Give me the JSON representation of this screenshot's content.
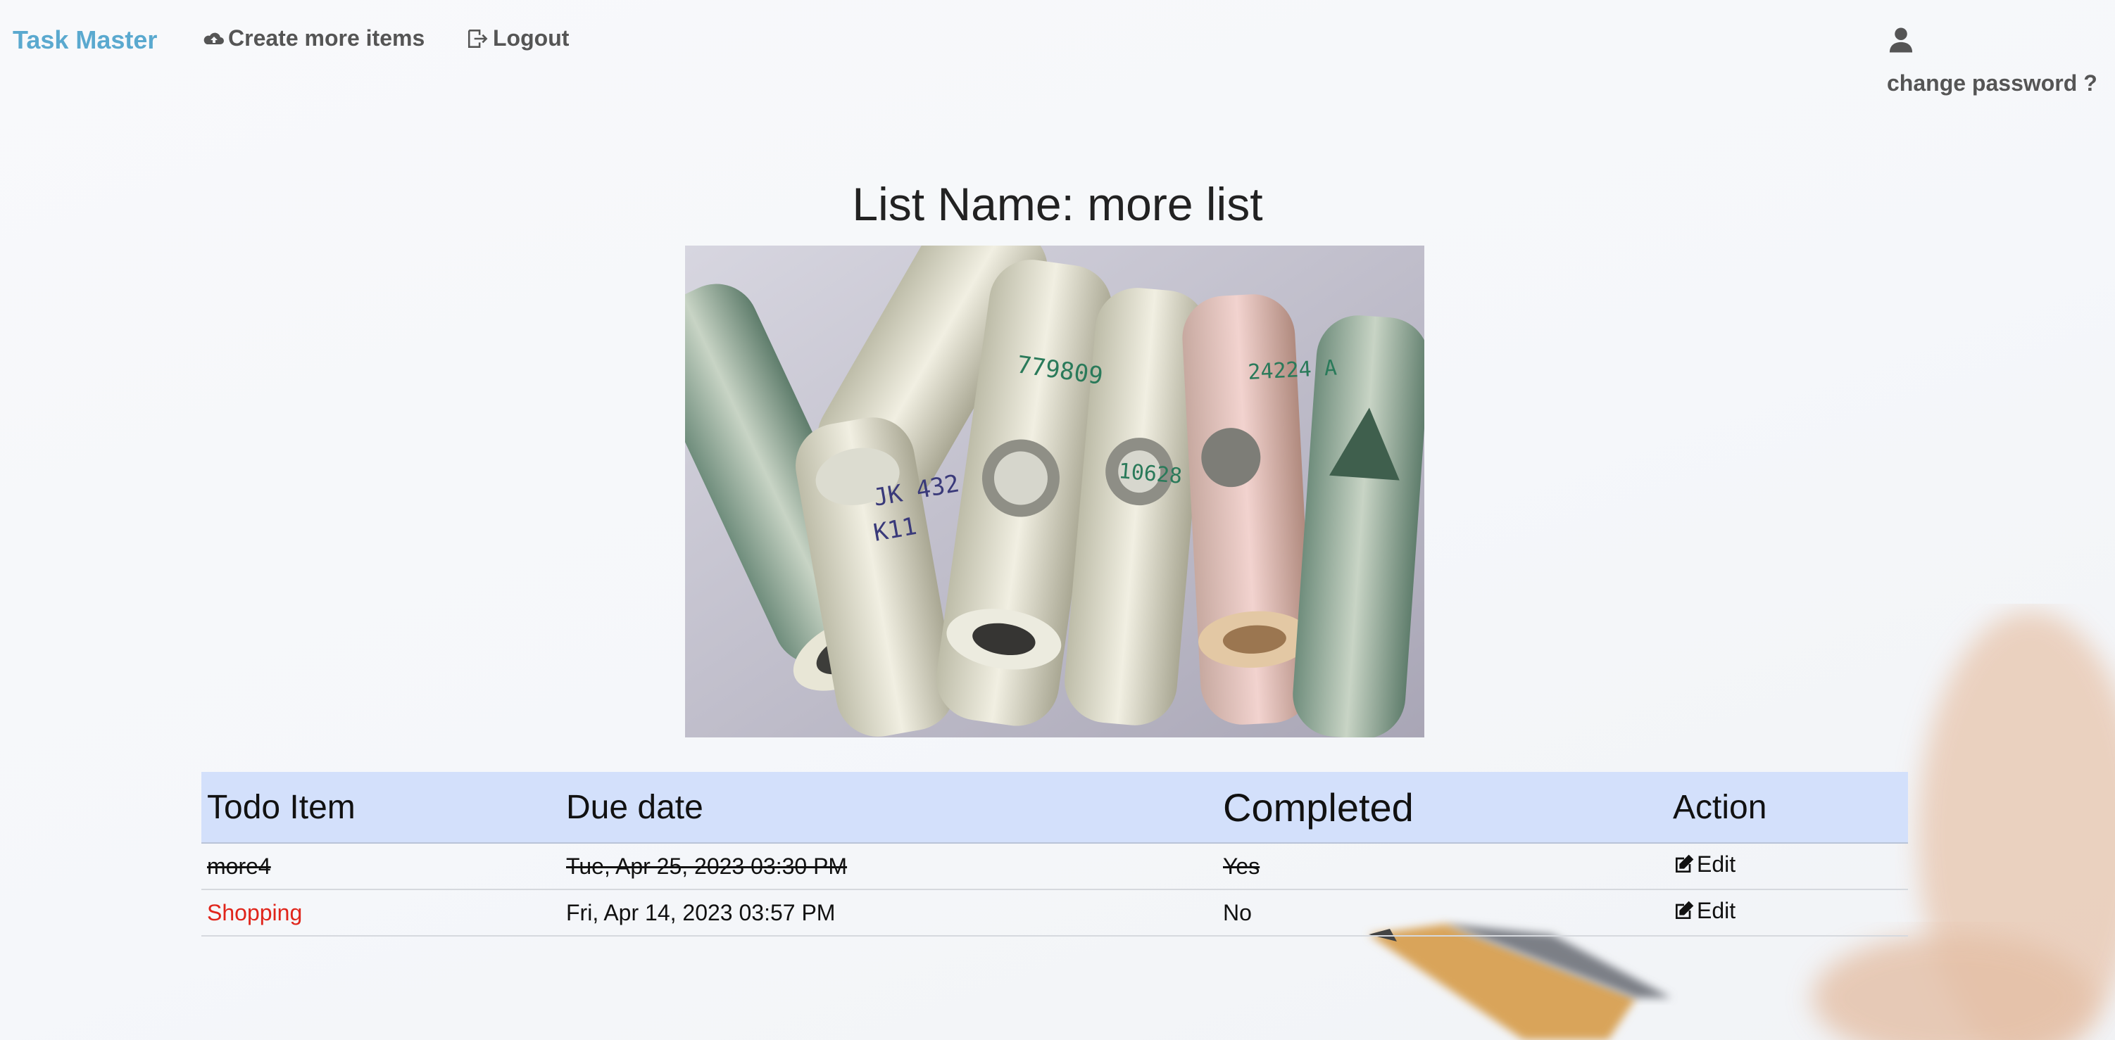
{
  "navbar": {
    "brand": "Task Master",
    "create_label": "Create more items",
    "logout_label": "Logout",
    "change_password_label": "change password ?"
  },
  "page": {
    "title": "List Name: more list"
  },
  "table": {
    "headers": [
      "Todo Item",
      "Due date",
      "Completed",
      "Action"
    ],
    "rows": [
      {
        "item": "more4",
        "due": "Tue, Apr 25, 2023 03:30 PM",
        "completed": "Yes",
        "action": "Edit",
        "done": true
      },
      {
        "item": "Shopping",
        "due": "Fri, Apr 14, 2023 03:57 PM",
        "completed": "No",
        "action": "Edit",
        "done": false
      }
    ]
  },
  "colors": {
    "brand": "#5aa9cf",
    "header_bg": "#d3e0fb",
    "overdue": "#e0251b"
  },
  "icons": {
    "create": "cloud-upload-icon",
    "logout": "logout-icon",
    "user": "user-icon",
    "edit": "edit-icon"
  }
}
